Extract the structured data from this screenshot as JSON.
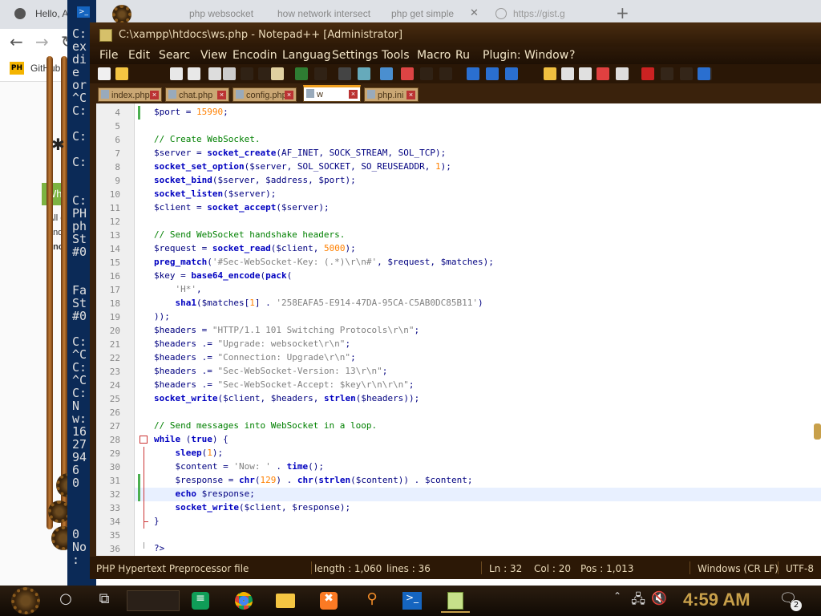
{
  "browser": {
    "tabs": [
      {
        "title": "Hello, Ad"
      },
      {
        "title": "php websocket"
      },
      {
        "title": "how network intersect"
      },
      {
        "title": "php get simple"
      },
      {
        "title": "https://gist.g"
      }
    ],
    "new_tab": "+",
    "bookmarks": [
      {
        "badge": "PH",
        "label": "GitHub"
      }
    ],
    "page_banner": "Wh",
    "page_text": [
      "All c",
      "and",
      "enc"
    ]
  },
  "console": {
    "lines": [
      "C:",
      "ex",
      "di",
      "e",
      "or",
      "^C",
      "C:",
      "",
      "C:",
      "",
      "C:",
      "",
      "",
      "C:",
      "PH",
      "ph",
      "St",
      "#0",
      "",
      "",
      "Fa",
      "St",
      "#0",
      "",
      "C:",
      "^C",
      "C:",
      "^C",
      "C:",
      "N",
      "w:",
      "16",
      "27",
      "94",
      "6",
      "0",
      "",
      "",
      "",
      "0",
      "No",
      ":"
    ]
  },
  "npp": {
    "title": "C:\\xampp\\htdocs\\ws.php - Notepad++ [Administrator]",
    "menu": [
      "File",
      "Edit",
      "Searc",
      "View",
      "Encodin",
      "Languag",
      "Settings",
      "Tools",
      "Macro",
      "Ru",
      "Plugin:",
      "Window",
      "?"
    ],
    "tabs": [
      {
        "label": "index.php",
        "active": false
      },
      {
        "label": "chat.php",
        "active": false
      },
      {
        "label": "config.php",
        "active": false
      },
      {
        "label": "w",
        "active": true
      },
      {
        "label": "php.ini",
        "active": false
      }
    ],
    "code_lines": [
      {
        "n": "4",
        "t": "$port = 15990;"
      },
      {
        "n": "5",
        "t": ""
      },
      {
        "n": "6",
        "t": "// Create WebSocket."
      },
      {
        "n": "7",
        "t": "$server = socket_create(AF_INET, SOCK_STREAM, SOL_TCP);"
      },
      {
        "n": "8",
        "t": "socket_set_option($server, SOL_SOCKET, SO_REUSEADDR, 1);"
      },
      {
        "n": "9",
        "t": "socket_bind($server, $address, $port);"
      },
      {
        "n": "10",
        "t": "socket_listen($server);"
      },
      {
        "n": "11",
        "t": "$client = socket_accept($server);"
      },
      {
        "n": "12",
        "t": ""
      },
      {
        "n": "13",
        "t": "// Send WebSocket handshake headers."
      },
      {
        "n": "14",
        "t": "$request = socket_read($client, 5000);"
      },
      {
        "n": "15",
        "t": "preg_match('#Sec-WebSocket-Key: (.*)\\r\\n#', $request, $matches);"
      },
      {
        "n": "16",
        "t": "$key = base64_encode(pack("
      },
      {
        "n": "17",
        "t": "    'H*',"
      },
      {
        "n": "18",
        "t": "    sha1($matches[1] . '258EAFA5-E914-47DA-95CA-C5AB0DC85B11')"
      },
      {
        "n": "19",
        "t": "));"
      },
      {
        "n": "20",
        "t": "$headers = \"HTTP/1.1 101 Switching Protocols\\r\\n\";"
      },
      {
        "n": "21",
        "t": "$headers .= \"Upgrade: websocket\\r\\n\";"
      },
      {
        "n": "22",
        "t": "$headers .= \"Connection: Upgrade\\r\\n\";"
      },
      {
        "n": "23",
        "t": "$headers .= \"Sec-WebSocket-Version: 13\\r\\n\";"
      },
      {
        "n": "24",
        "t": "$headers .= \"Sec-WebSocket-Accept: $key\\r\\n\\r\\n\";"
      },
      {
        "n": "25",
        "t": "socket_write($client, $headers, strlen($headers));"
      },
      {
        "n": "26",
        "t": ""
      },
      {
        "n": "27",
        "t": "// Send messages into WebSocket in a loop."
      },
      {
        "n": "28",
        "t": "while (true) {"
      },
      {
        "n": "29",
        "t": "    sleep(1);"
      },
      {
        "n": "30",
        "t": "    $content = 'Now: ' . time();"
      },
      {
        "n": "31",
        "t": "    $response = chr(129) . chr(strlen($content)) . $content;"
      },
      {
        "n": "32",
        "t": "    echo $response;"
      },
      {
        "n": "33",
        "t": "    socket_write($client, $response);"
      },
      {
        "n": "34",
        "t": "}"
      },
      {
        "n": "35",
        "t": ""
      },
      {
        "n": "36",
        "t": "?>"
      }
    ],
    "status": {
      "file_type": "PHP Hypertext Preprocessor file",
      "length": "length : 1,060",
      "lines": "lines : 36",
      "ln": "Ln : 32",
      "col": "Col : 20",
      "pos": "Pos : 1,013",
      "eol": "Windows (CR LF)",
      "encoding": "UTF-8"
    }
  },
  "taskbar": {
    "clock": "4:59 AM",
    "notification_count": "2",
    "apps": [
      "start",
      "cortana",
      "task-view",
      "search-box",
      "hangouts",
      "chrome",
      "file-explorer",
      "xampp",
      "search-tool",
      "powershell",
      "notepad-plus-plus"
    ]
  },
  "colors": {
    "accent": "#f0a020",
    "wood": "#3a220c",
    "comment": "#008000",
    "keyword": "#0000c0"
  }
}
